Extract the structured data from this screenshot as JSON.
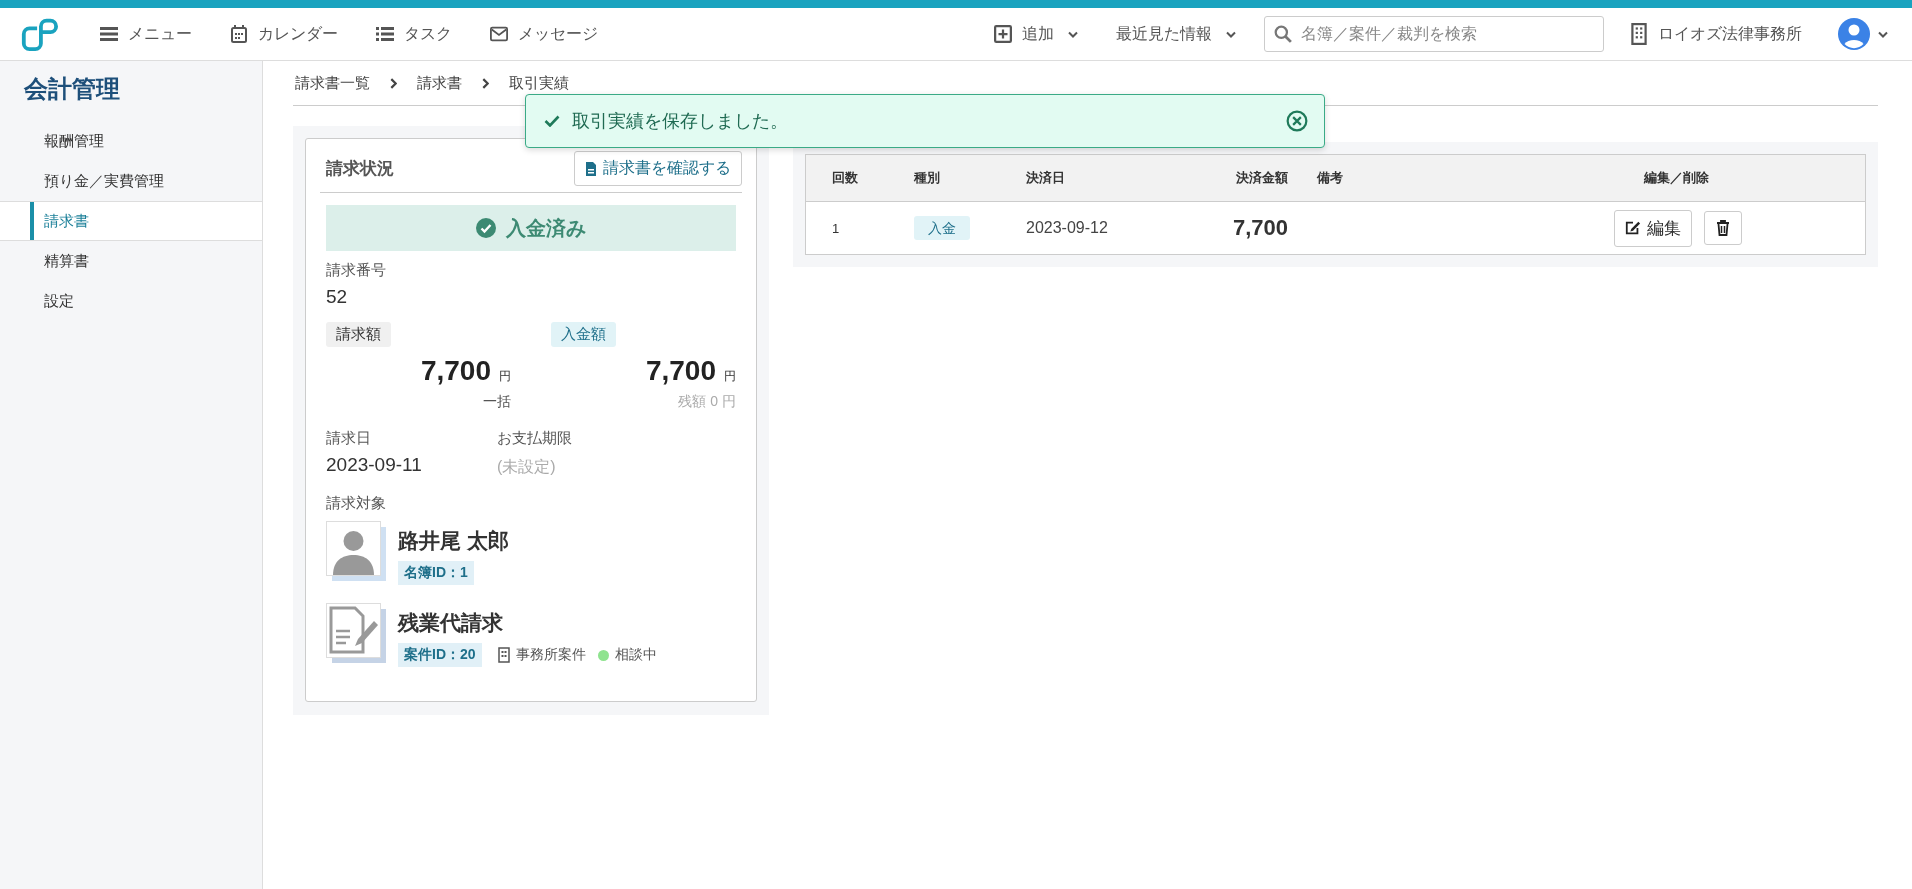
{
  "topbar": {
    "nav": [
      {
        "kind": "menu",
        "label": "メニュー"
      },
      {
        "kind": "calendar",
        "label": "カレンダー"
      },
      {
        "kind": "tasks",
        "label": "タスク"
      },
      {
        "kind": "mail",
        "label": "メッセージ"
      }
    ],
    "add_label": "追加",
    "recent_label": "最近見た情報",
    "search": {
      "placeholder": "名簿／案件／裁判を検索"
    },
    "office": "ロイオズ法律事務所"
  },
  "sidebar": {
    "title": "会計管理",
    "items": [
      {
        "label": "報酬管理",
        "selected": false
      },
      {
        "label": "預り金／実費管理",
        "selected": false
      },
      {
        "label": "請求書",
        "selected": true
      },
      {
        "label": "精算書",
        "selected": false
      },
      {
        "label": "設定",
        "selected": false
      }
    ]
  },
  "breadcrumb": [
    "請求書一覧",
    "請求書",
    "取引実績"
  ],
  "toast": {
    "message": "取引実績を保存しました。"
  },
  "status_card": {
    "title": "請求状況",
    "confirm_button": "請求書を確認する",
    "status": "入金済み",
    "invoice_number": {
      "label": "請求番号",
      "value": "52"
    },
    "billed": {
      "label": "請求額",
      "amount": "7,700",
      "unit": "円",
      "note": "一括"
    },
    "paid": {
      "label": "入金額",
      "amount": "7,700",
      "unit": "円",
      "note": "残額 0 円"
    },
    "invoice_date": {
      "label": "請求日",
      "value": "2023-09-11"
    },
    "due_date": {
      "label": "お支払期限",
      "value": "(未設定)"
    },
    "target_label": "請求対象",
    "client": {
      "name": "路井尾 太郎",
      "id": "名簿ID：1"
    },
    "matter": {
      "name": "残業代請求",
      "id": "案件ID：20",
      "type": "事務所案件",
      "status": "相談中",
      "color": "#8fe38f"
    }
  },
  "transactions": {
    "columns": [
      "回数",
      "種別",
      "決済日",
      "決済金額",
      "備考",
      "編集／削除"
    ],
    "rows": [
      {
        "number": "1",
        "type": "入金",
        "date": "2023-09-12",
        "amount": "7,700",
        "edit": "編集"
      }
    ]
  }
}
